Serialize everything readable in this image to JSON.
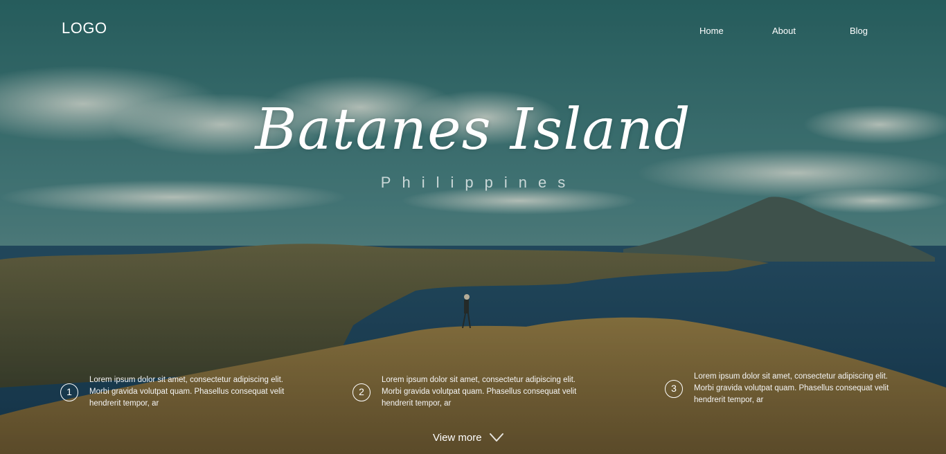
{
  "header": {
    "logo": "LOGO",
    "nav": [
      {
        "label": "Home"
      },
      {
        "label": "About"
      },
      {
        "label": "Blog"
      }
    ]
  },
  "hero": {
    "title": "Batanes Island",
    "subtitle": "Philippines",
    "background": "photo-landscape-hill-sea-volcano"
  },
  "features": [
    {
      "number": "1",
      "text": "Lorem ipsum dolor sit amet, consectetur adipiscing elit. Morbi gravida volutpat quam. Phasellus consequat velit  hendrerit tempor, ar"
    },
    {
      "number": "2",
      "text": "Lorem ipsum dolor sit amet, consectetur adipiscing elit. Morbi gravida volutpat quam. Phasellus consequat velit  hendrerit tempor, ar"
    },
    {
      "number": "3",
      "text": "Lorem ipsum dolor sit amet, consectetur adipiscing elit. Morbi gravida volutpat quam. Phasellus consequat velit  hendrerit tempor, ar"
    }
  ],
  "view_more": {
    "label": "View more",
    "icon": "chevron-down-icon"
  },
  "colors": {
    "sky_top": "#2f6b6c",
    "sea": "#1d3f5a",
    "grass": "#8a6a35",
    "text": "#ffffff"
  }
}
